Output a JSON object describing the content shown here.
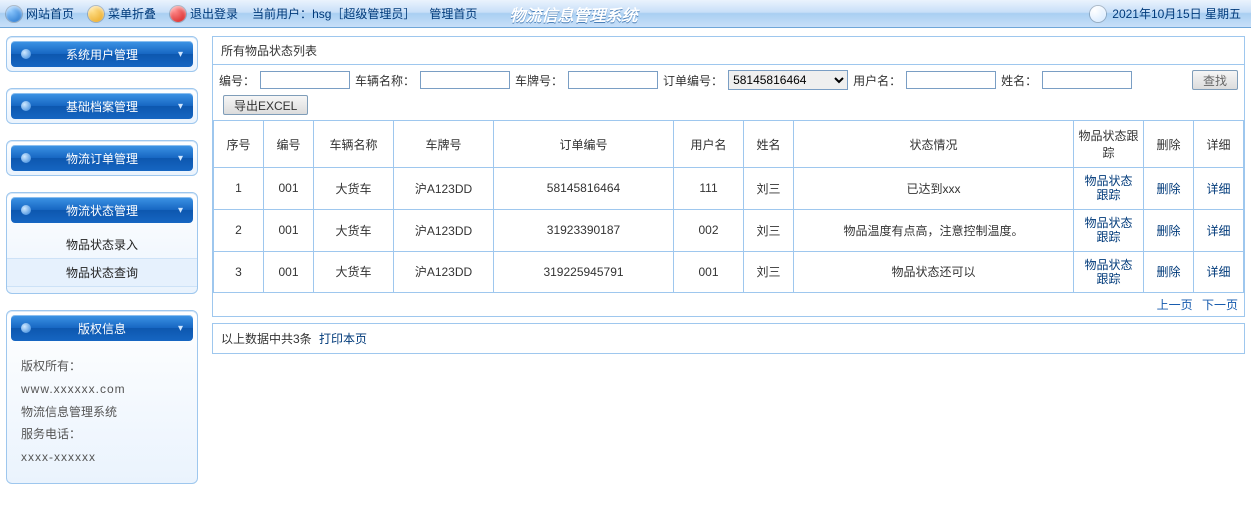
{
  "topbar": {
    "home": "网站首页",
    "collapse": "菜单折叠",
    "logout": "退出登录",
    "current_user_label": "当前用户：",
    "current_user_value": "hsg［超级管理员］",
    "admin_home": "管理首页",
    "system_title": "物流信息管理系统",
    "date": "2021年10月15日 星期五"
  },
  "side": {
    "sections": [
      {
        "title": "系统用户管理"
      },
      {
        "title": "基础档案管理"
      },
      {
        "title": "物流订单管理"
      },
      {
        "title": "物流状态管理",
        "items": [
          "物品状态录入",
          "物品状态查询"
        ],
        "activeIndex": 1
      },
      {
        "title": "版权信息"
      }
    ],
    "copyright": {
      "l1": "版权所有：",
      "l2": "www.xxxxxx.com",
      "l3": "物流信息管理系统",
      "l4": "服务电话：",
      "l5": "xxxx-xxxxxx"
    }
  },
  "content": {
    "list_title": "所有物品状态列表",
    "filters": {
      "f1": "编号：",
      "f2": "车辆名称：",
      "f3": "车牌号：",
      "f4": "订单编号：",
      "f4_value": "58145816464",
      "f5": "用户名：",
      "f6": "姓名：",
      "btn_search": "查找",
      "btn_export": "导出EXCEL"
    },
    "columns": [
      "序号",
      "编号",
      "车辆名称",
      "车牌号",
      "订单编号",
      "用户名",
      "姓名",
      "状态情况",
      "物品状态跟踪",
      "删除",
      "详细"
    ],
    "rows": [
      {
        "idx": "1",
        "code": "001",
        "vehicle": "大货车",
        "plate": "沪A123DD",
        "order": "58145816464",
        "user": "111",
        "name": "刘三",
        "status": "已达到xxx",
        "track": "物品状态跟踪",
        "del": "删除",
        "detail": "详细"
      },
      {
        "idx": "2",
        "code": "001",
        "vehicle": "大货车",
        "plate": "沪A123DD",
        "order": "31923390187",
        "user": "002",
        "name": "刘三",
        "status": "物品温度有点高，注意控制温度。",
        "track": "物品状态跟踪",
        "del": "删除",
        "detail": "详细"
      },
      {
        "idx": "3",
        "code": "001",
        "vehicle": "大货车",
        "plate": "沪A123DD",
        "order": "319225945791",
        "user": "001",
        "name": "刘三",
        "status": "物品状态还可以",
        "track": "物品状态跟踪",
        "del": "删除",
        "detail": "详细"
      }
    ],
    "pager_prev": "上一页",
    "pager_next": "下一页",
    "footer_count": "以上数据中共3条",
    "footer_print": "打印本页"
  }
}
